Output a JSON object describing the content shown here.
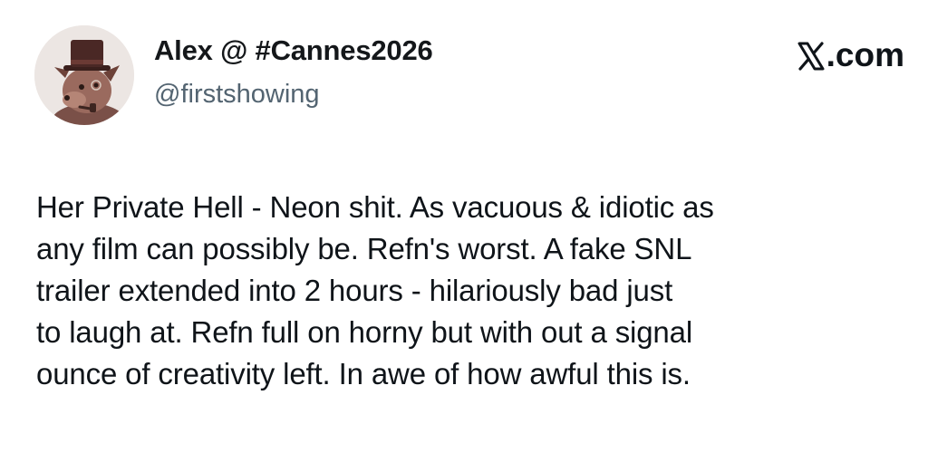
{
  "tweet": {
    "display_name": "Alex @ #Cannes2026",
    "handle": "@firstshowing",
    "site_label": ".com",
    "site_icon": "x-logo-icon",
    "body_lines": [
      "Her Private Hell - Neon shit. As vacuous & idiotic as",
      "any film can possibly be. Refn's worst. A fake SNL",
      "trailer extended into 2 hours - hilariously bad just",
      "to laugh at. Refn full on horny but with out a signal",
      "ounce of creativity left. In awe of how awful this is."
    ]
  },
  "colors": {
    "text": "#0f1419",
    "handle": "#536471",
    "background": "#ffffff"
  }
}
